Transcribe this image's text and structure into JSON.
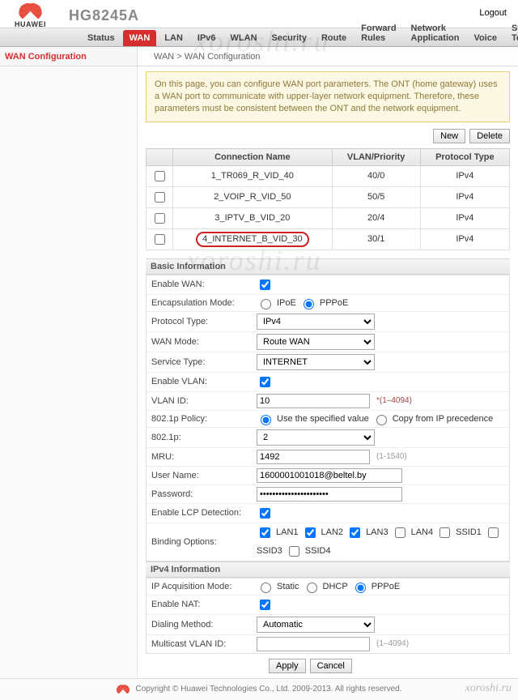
{
  "header": {
    "brand": "HUAWEI",
    "model": "HG8245A",
    "logout": "Logout"
  },
  "nav": {
    "items": [
      "Status",
      "WAN",
      "LAN",
      "IPv6",
      "WLAN",
      "Security",
      "Route",
      "Forward Rules",
      "Network Application",
      "Voice",
      "System Tools"
    ],
    "active_index": 1
  },
  "sub": {
    "sidebar_title": "WAN Configuration",
    "breadcrumb": "WAN > WAN Configuration"
  },
  "info": "On this page, you can configure WAN port parameters. The ONT (home gateway) uses a WAN port to communicate with upper-layer network equipment. Therefore, these parameters must be consistent between the ONT and the network equipment.",
  "buttons": {
    "new": "New",
    "delete": "Delete",
    "apply": "Apply",
    "cancel": "Cancel"
  },
  "conn_table": {
    "headers": [
      "",
      "Connection Name",
      "VLAN/Priority",
      "Protocol Type"
    ],
    "rows": [
      {
        "name": "1_TR069_R_VID_40",
        "vlan": "40/0",
        "proto": "IPv4"
      },
      {
        "name": "2_VOIP_R_VID_50",
        "vlan": "50/5",
        "proto": "IPv4"
      },
      {
        "name": "3_IPTV_B_VID_20",
        "vlan": "20/4",
        "proto": "IPv4"
      },
      {
        "name": "4_INTERNET_B_VID_30",
        "vlan": "30/1",
        "proto": "IPv4"
      }
    ],
    "circled_index": 3
  },
  "sections": {
    "basic": "Basic Information",
    "ipv4": "IPv4 Information"
  },
  "form": {
    "enable_wan": {
      "label": "Enable WAN:",
      "checked": true
    },
    "encap": {
      "label": "Encapsulation Mode:",
      "options": [
        "IPoE",
        "PPPoE"
      ],
      "selected": 1
    },
    "proto": {
      "label": "Protocol Type:",
      "value": "IPv4"
    },
    "wanmode": {
      "label": "WAN Mode:",
      "value": "Route WAN"
    },
    "svctype": {
      "label": "Service Type:",
      "value": "INTERNET"
    },
    "enable_vlan": {
      "label": "Enable VLAN:",
      "checked": true
    },
    "vlan_id": {
      "label": "VLAN ID:",
      "value": "10",
      "hint": "*(1–4094)"
    },
    "policy": {
      "label": "802.1p Policy:",
      "options": [
        "Use the specified value",
        "Copy from IP precedence"
      ],
      "selected": 0
    },
    "p8021": {
      "label": "802.1p:",
      "value": "2"
    },
    "mru": {
      "label": "MRU:",
      "value": "1492",
      "hint": "(1-1540)"
    },
    "user": {
      "label": "User Name:",
      "value": "1600001001018@beltel.by"
    },
    "pass": {
      "label": "Password:",
      "value": "••••••••••••••••••••••"
    },
    "lcp": {
      "label": "Enable LCP Detection:",
      "checked": true
    },
    "bind": {
      "label": "Binding Options:",
      "items": [
        {
          "label": "LAN1",
          "checked": true
        },
        {
          "label": "LAN2",
          "checked": true
        },
        {
          "label": "LAN3",
          "checked": true
        },
        {
          "label": "LAN4",
          "checked": false
        },
        {
          "label": "SSID1",
          "checked": false
        },
        {
          "label": "SSID3",
          "checked": false
        },
        {
          "label": "SSID4",
          "checked": false
        }
      ]
    },
    "acq": {
      "label": "IP Acquisition Mode:",
      "options": [
        "Static",
        "DHCP",
        "PPPoE"
      ],
      "selected": 2
    },
    "nat": {
      "label": "Enable NAT:",
      "checked": true
    },
    "dial": {
      "label": "Dialing Method:",
      "value": "Automatic"
    },
    "mcast": {
      "label": "Multicast VLAN ID:",
      "value": "",
      "hint": "(1–4094)"
    }
  },
  "footer": "Copyright © Huawei Technologies Co., Ltd. 2009-2013. All rights reserved.",
  "wm1": "xoroshi.ru",
  "wm2": "xoroshi.ru",
  "wm3": "xoroshi.ru"
}
